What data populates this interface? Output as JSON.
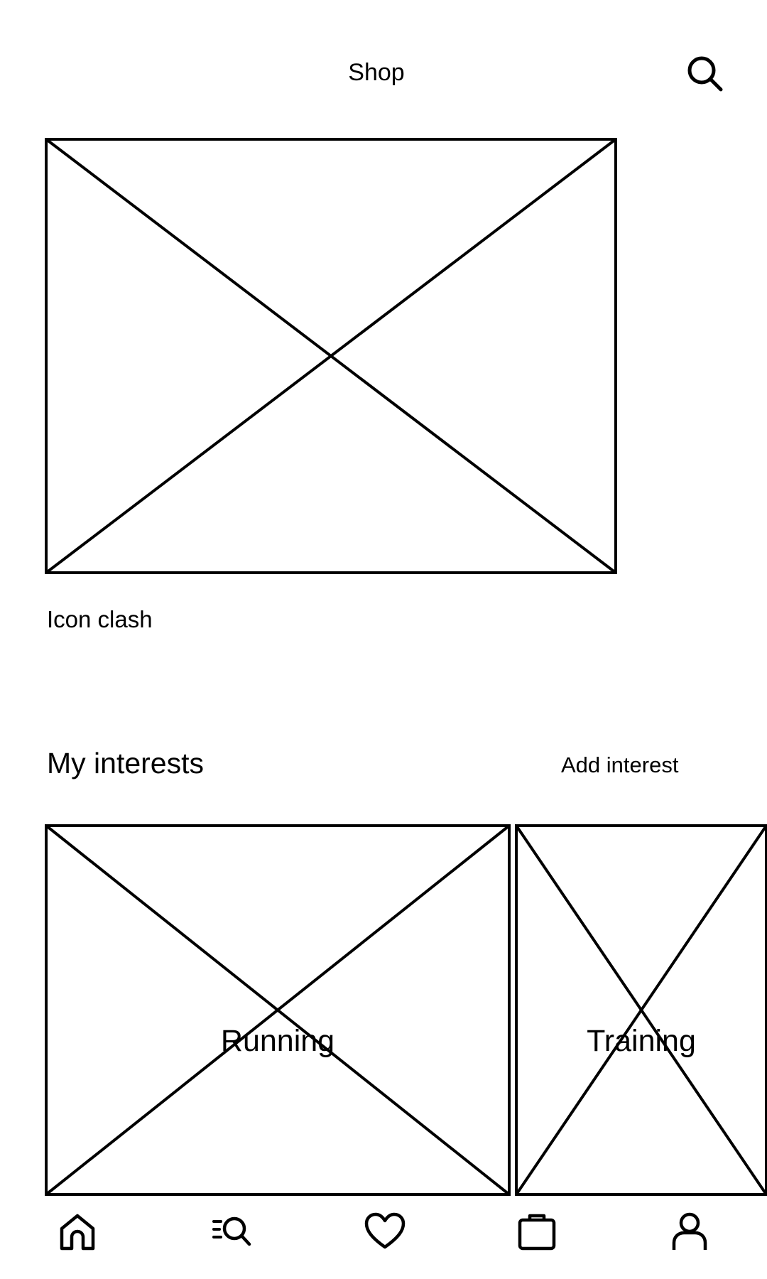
{
  "header": {
    "title": "Shop",
    "search_icon": "search-icon"
  },
  "hero": {
    "caption": "Icon clash"
  },
  "interests": {
    "title": "My interests",
    "add_label": "Add interest",
    "cards": [
      {
        "label": "Running"
      },
      {
        "label": "Training"
      }
    ]
  },
  "bottom_nav": {
    "items": [
      {
        "icon": "home-icon"
      },
      {
        "icon": "discover-search-icon"
      },
      {
        "icon": "heart-icon"
      },
      {
        "icon": "bag-icon"
      },
      {
        "icon": "profile-icon"
      }
    ]
  },
  "colors": {
    "line": "#000000",
    "background": "#ffffff"
  }
}
